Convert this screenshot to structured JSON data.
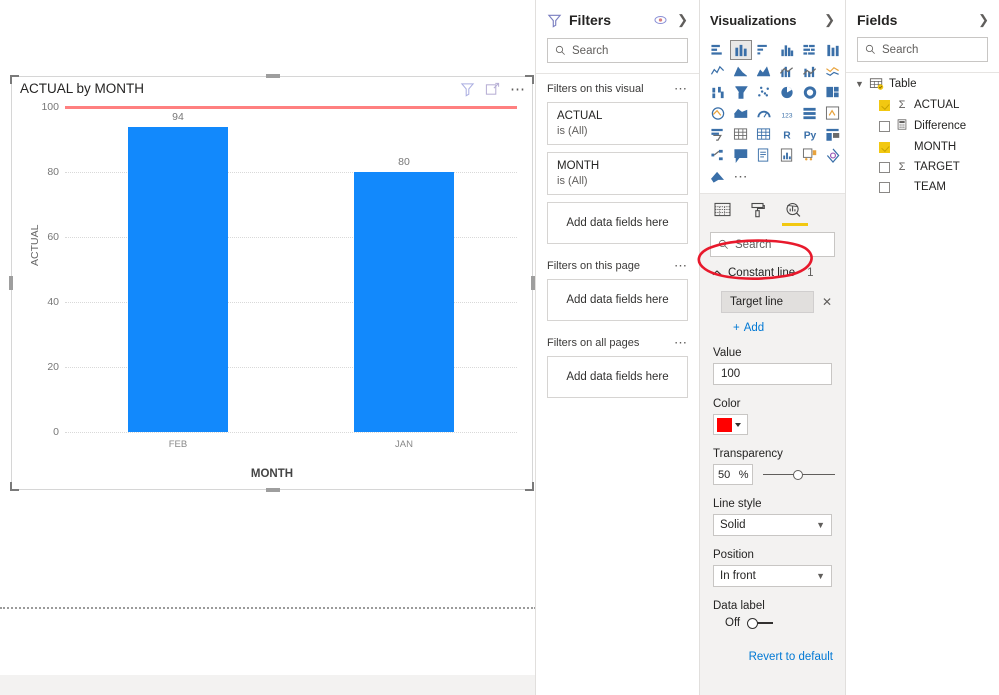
{
  "canvas": {
    "visual": {
      "title": "ACTUAL by MONTH",
      "header_icons": [
        {
          "name": "filter-icon",
          "label": "Filters"
        },
        {
          "name": "focus-mode-icon",
          "label": "Focus mode"
        },
        {
          "name": "more-options-icon",
          "label": "More options"
        }
      ]
    }
  },
  "chart_data": {
    "type": "bar",
    "title": "ACTUAL by MONTH",
    "categories": [
      "FEB",
      "JAN"
    ],
    "values": [
      94,
      80
    ],
    "data_labels": [
      "94",
      "80"
    ],
    "xlabel": "MONTH",
    "ylabel": "ACTUAL",
    "ylim": [
      0,
      100
    ],
    "yticks": [
      0,
      20,
      40,
      60,
      80,
      100
    ],
    "ytick_labels": [
      "0",
      "20",
      "40",
      "60",
      "80",
      "100"
    ],
    "grid": true,
    "legend": "none",
    "bar_color": "#1289fc",
    "constant_line": {
      "name": "Target line",
      "value": 100,
      "color": "#ff0000",
      "rendered_color": "#ff8080",
      "transparency": "50",
      "line_style": "Solid",
      "position": "In front",
      "data_label": "Off"
    }
  },
  "filters": {
    "title": "Filters",
    "hide_icon": "eye-hide-icon",
    "collapse_icon": "chevron-right-icon",
    "search_placeholder": "Search",
    "sections": [
      {
        "heading": "Filters on this visual",
        "cards": [
          {
            "field": "ACTUAL",
            "value": "is (All)"
          },
          {
            "field": "MONTH",
            "value": "is (All)"
          }
        ],
        "dropzone": "Add data fields here"
      },
      {
        "heading": "Filters on this page",
        "cards": [],
        "dropzone": "Add data fields here"
      },
      {
        "heading": "Filters on all pages",
        "cards": [],
        "dropzone": "Add data fields here"
      }
    ]
  },
  "visualizations": {
    "title": "Visualizations",
    "collapse_icon": "chevron-right-icon",
    "icons": [
      "stacked-bar-chart-icon",
      "stacked-column-chart-icon",
      "clustered-bar-chart-icon",
      "clustered-column-chart-icon",
      "100-stacked-bar-chart-icon",
      "100-stacked-column-chart-icon",
      "line-chart-icon",
      "area-chart-icon",
      "stacked-area-chart-icon",
      "line-stacked-column-chart-icon",
      "line-clustered-column-chart-icon",
      "ribbon-chart-icon",
      "waterfall-chart-icon",
      "funnel-icon",
      "scatter-chart-icon",
      "pie-chart-icon",
      "donut-chart-icon",
      "treemap-icon",
      "map-icon",
      "filled-map-icon",
      "gauge-icon",
      "card-icon",
      "multi-row-card-icon",
      "kpi-icon",
      "slicer-icon",
      "table-icon",
      "matrix-icon",
      "r-script-visual-icon",
      "python-visual-icon",
      "key-influencers-icon",
      "decomposition-tree-icon",
      "q-and-a-icon",
      "smart-narrative-icon",
      "paginated-report-icon",
      "power-apps-icon",
      "power-automate-icon",
      "arcgis-maps-icon",
      "more-visuals-icon"
    ],
    "selected_icon_index": 1,
    "format_tabs": [
      {
        "name": "fields-tab",
        "icon": "fields-table-icon",
        "active": false
      },
      {
        "name": "format-tab",
        "icon": "paint-roller-icon",
        "active": false
      },
      {
        "name": "analytics-tab",
        "icon": "analytics-magnifier-icon",
        "active": true
      }
    ],
    "search_placeholder": "Search",
    "analytics": {
      "card_title": "Constant line",
      "card_count": "1",
      "card_expanded": true,
      "chip_label": "Target line",
      "chip_remove_icon": "close-icon",
      "add_label": "Add",
      "fields": [
        {
          "label": "Value",
          "value": "100",
          "type": "text"
        },
        {
          "label": "Color",
          "value": "#ff0000",
          "type": "color"
        },
        {
          "label": "Transparency",
          "value": "50",
          "unit": "%",
          "type": "slider"
        },
        {
          "label": "Line style",
          "value": "Solid",
          "type": "select"
        },
        {
          "label": "Position",
          "value": "In front",
          "type": "select"
        },
        {
          "label": "Data label",
          "value": "Off",
          "type": "toggle"
        }
      ],
      "revert_label": "Revert to default"
    }
  },
  "fields": {
    "title": "Fields",
    "collapse_icon": "chevron-right-icon",
    "search_placeholder": "Search",
    "table": {
      "name": "Table",
      "expanded": true,
      "items": [
        {
          "label": "ACTUAL",
          "checked": true,
          "icon": "sigma-icon"
        },
        {
          "label": "Difference",
          "checked": false,
          "icon": "calculator-icon"
        },
        {
          "label": "MONTH",
          "checked": true,
          "icon": "none"
        },
        {
          "label": "TARGET",
          "checked": false,
          "icon": "sigma-icon"
        },
        {
          "label": "TEAM",
          "checked": false,
          "icon": "none"
        }
      ]
    }
  },
  "annotation": {
    "type": "hand-drawn-ellipse",
    "color": "#e8192c",
    "target": "Constant line 1"
  }
}
